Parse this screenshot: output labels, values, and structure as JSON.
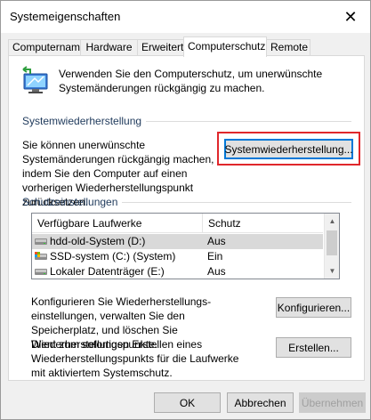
{
  "window": {
    "title": "Systemeigenschaften",
    "close_glyph": "✕"
  },
  "tabs": [
    {
      "label": "Computername"
    },
    {
      "label": "Hardware"
    },
    {
      "label": "Erweitert"
    },
    {
      "label": "Computerschutz",
      "active": true
    },
    {
      "label": "Remote"
    }
  ],
  "intro": {
    "text": "Verwenden Sie den Computerschutz, um unerwünschte Systemänderungen rückgängig zu machen.",
    "icon": "system-protection-icon"
  },
  "restore": {
    "section_label": "Systemwiederherstellung",
    "description": "Sie können unerwünschte Systemänderungen rückgängig machen, indem Sie den Computer auf einen vorherigen Wiederherstellungspunkt zurücksetzen.",
    "button_label": "Systemwiederherstellung..."
  },
  "protection": {
    "section_label": "Schutzeinstellungen",
    "columns": [
      "Verfügbare Laufwerke",
      "Schutz"
    ],
    "drives": [
      {
        "name": "hdd-old-System (D:)",
        "status": "Aus",
        "icon": "hdd-drive-icon",
        "selected": true
      },
      {
        "name": "SSD-system (C:) (System)",
        "status": "Ein",
        "icon": "system-drive-icon"
      },
      {
        "name": "Lokaler Datenträger (E:)",
        "status": "Aus",
        "icon": "hdd-drive-icon"
      }
    ],
    "configure_text": "Konfigurieren Sie Wiederherstellungs-einstellungen, verwalten Sie den Speicherplatz, und löschen Sie Wiederherstellungspunkte.",
    "configure_button": "Konfigurieren...",
    "create_text": "Dient zum sofortigen Erstellen eines Wiederherstellungspunkts für die Laufwerke mit aktiviertem Systemschutz.",
    "create_button": "Erstellen..."
  },
  "footer": {
    "ok": "OK",
    "cancel": "Abbrechen",
    "apply": "Übernehmen"
  },
  "colors": {
    "highlight": "#e0272b",
    "focus": "#0078d7",
    "section_label": "#1e395b"
  }
}
